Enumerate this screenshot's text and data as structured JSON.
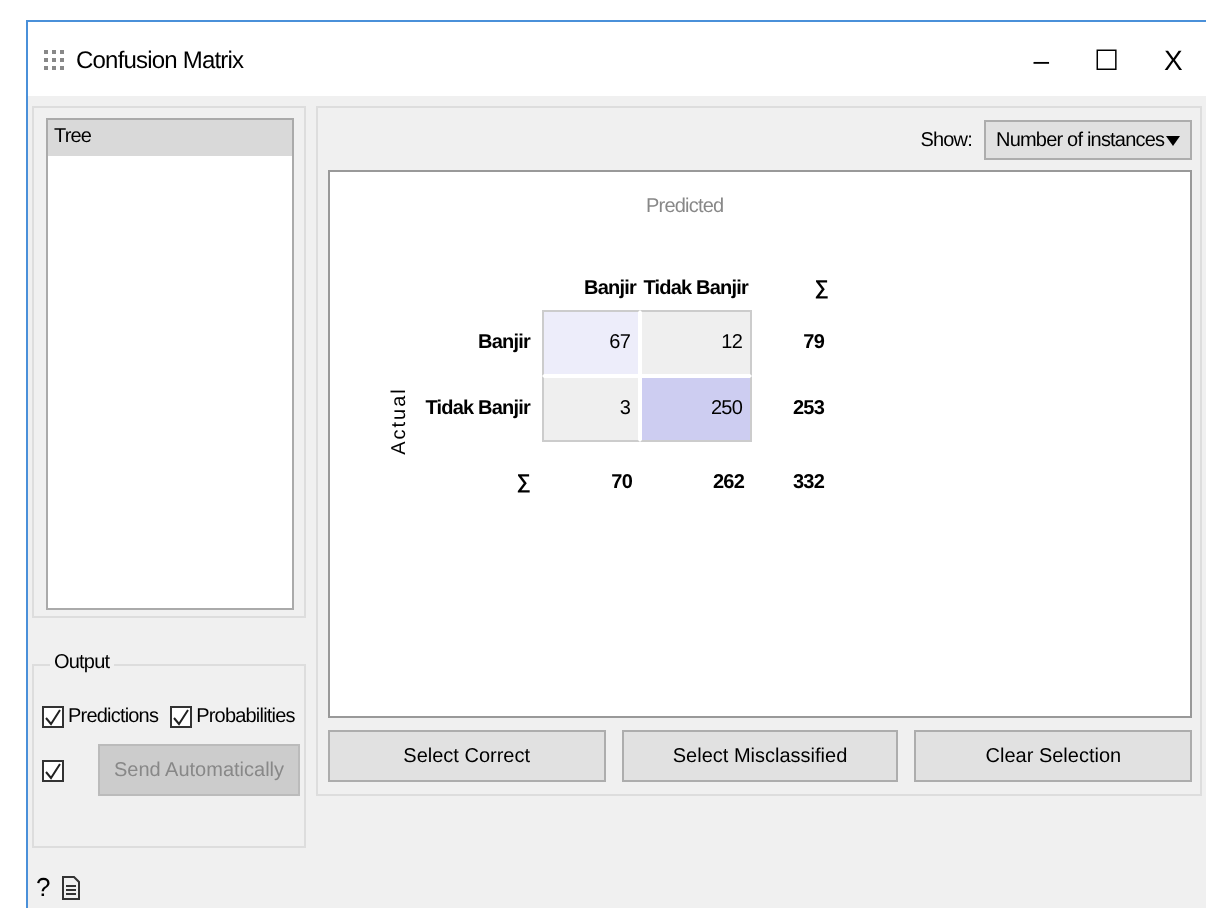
{
  "window": {
    "title": "Confusion Matrix",
    "controls": [
      "–",
      "☐",
      "X"
    ]
  },
  "learners": [
    {
      "label": "Tree",
      "selected": true
    }
  ],
  "output": {
    "title": "Output",
    "checkboxes": [
      {
        "label": "Predictions",
        "checked": true
      },
      {
        "label": "Probabilities",
        "checked": true
      }
    ],
    "auto_send": {
      "checked": true,
      "label": "Send Automatically",
      "disabled": true
    }
  },
  "show": {
    "label": "Show:",
    "value": "Number of instances"
  },
  "matrix": {
    "predicted_label": "Predicted",
    "actual_label": "Actual",
    "columns": [
      "Banjir",
      "Tidak Banjir",
      "∑"
    ],
    "rows": [
      {
        "label": "Banjir",
        "cells": [
          {
            "value": "67",
            "color": "#ededfa"
          },
          {
            "value": "12",
            "color": "#efefef"
          }
        ],
        "total": "79"
      },
      {
        "label": "Tidak Banjir",
        "cells": [
          {
            "value": "3",
            "color": "#efefef"
          },
          {
            "value": "250",
            "color": "#cdcdf1"
          }
        ],
        "total": "253"
      }
    ],
    "totals": {
      "label": "∑",
      "values": [
        "70",
        "262",
        "332"
      ]
    }
  },
  "buttons": [
    "Select Correct",
    "Select Misclassified",
    "Clear Selection"
  ],
  "footer": {
    "help": "?"
  }
}
